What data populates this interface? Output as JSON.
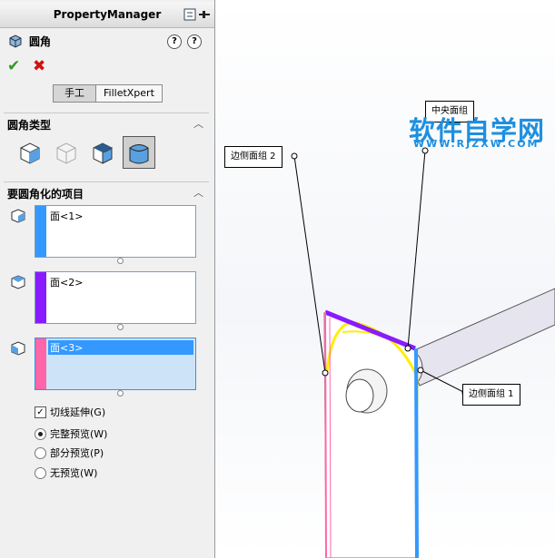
{
  "panel": {
    "header_title": "PropertyManager",
    "feature_name": "圆角",
    "tabs": [
      {
        "label": "手工",
        "active": true
      },
      {
        "label": "FilletXpert",
        "active": false
      }
    ]
  },
  "sections": {
    "fillet_type": {
      "title": "圆角类型"
    },
    "items": {
      "title": "要圆角化的项目"
    }
  },
  "face_lists": [
    {
      "entry": "面<1>",
      "color": "#3399ff"
    },
    {
      "entry": "面<2>",
      "color": "#8a1aff"
    },
    {
      "entry": "面<3>",
      "color": "#ff66aa"
    }
  ],
  "options": {
    "tangent_propagation": {
      "label": "切线延伸(G)",
      "checked": true
    },
    "preview": [
      {
        "label": "完整预览(W)",
        "selected": true
      },
      {
        "label": "部分预览(P)",
        "selected": false
      },
      {
        "label": "无预览(W)",
        "selected": false
      }
    ]
  },
  "callouts": {
    "side_face_2": "边侧面组 2",
    "side_face_1": "边侧面组 1",
    "center_face": "中央面组"
  },
  "watermark": {
    "brand": "软件自学网",
    "url": "WWW.RJZXW.COM"
  },
  "colors": {
    "accent_blue": "#3399ff",
    "edge_purple": "#8a1aff",
    "edge_pink": "#ff66aa",
    "fillet_yellow": "#ffee00",
    "ok_green": "#2a9d1c",
    "cancel_red": "#d01010"
  }
}
